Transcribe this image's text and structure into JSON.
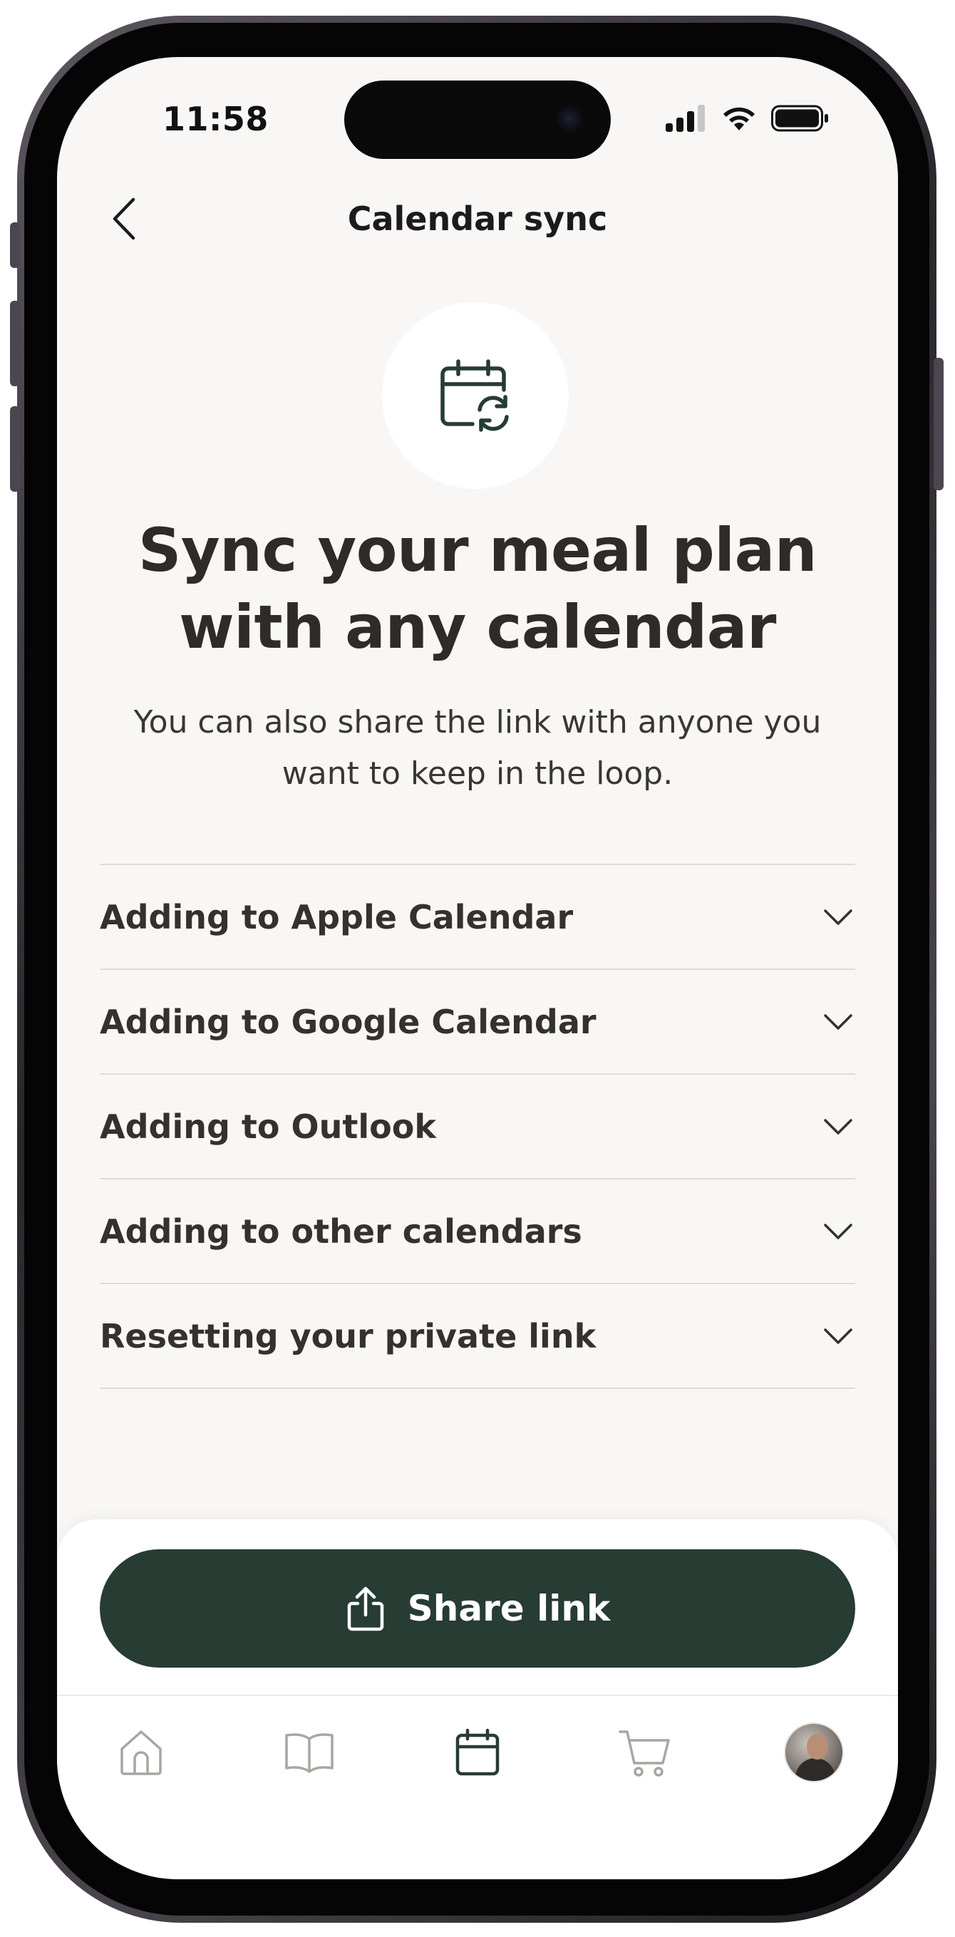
{
  "status_bar": {
    "time": "11:58"
  },
  "nav": {
    "title": "Calendar sync",
    "back_icon": "chevron-left-icon"
  },
  "hero": {
    "icon": "calendar-sync-icon",
    "headline": "Sync your meal plan with any calendar",
    "subtext": "You can also share the link with anyone you want to keep in the loop."
  },
  "accordion": {
    "items": [
      {
        "label": "Adding to Apple Calendar"
      },
      {
        "label": "Adding to Google Calendar"
      },
      {
        "label": "Adding to Outlook"
      },
      {
        "label": "Adding to other calendars"
      },
      {
        "label": "Resetting your private link"
      }
    ],
    "chevron_icon": "chevron-down-icon"
  },
  "share_button": {
    "label": "Share link",
    "icon": "share-icon"
  },
  "tab_bar": {
    "tabs": [
      {
        "name": "home",
        "icon": "home-icon",
        "active": false
      },
      {
        "name": "recipes",
        "icon": "book-icon",
        "active": false
      },
      {
        "name": "plan",
        "icon": "calendar-icon",
        "active": true
      },
      {
        "name": "groceries",
        "icon": "cart-icon",
        "active": false
      },
      {
        "name": "profile",
        "icon": "avatar",
        "active": false
      }
    ]
  },
  "colors": {
    "accent": "#273c33",
    "background": "#f8f7f5",
    "text_primary": "#2e2b28",
    "divider": "#dedcd8",
    "tab_inactive": "#a9a6a2",
    "tab_active": "#273c33"
  }
}
